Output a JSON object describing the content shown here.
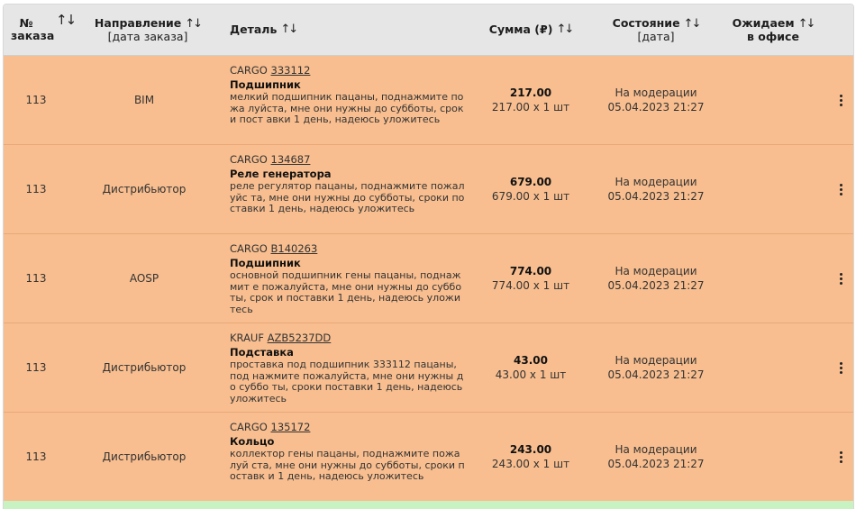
{
  "header": {
    "num": {
      "line1": "№",
      "line2": "заказа",
      "sort": "↑↓"
    },
    "direction": {
      "line1": "Направление",
      "line2": "[дата заказа]",
      "sort": "↑↓"
    },
    "detail": {
      "label": "Деталь",
      "sort": "↑↓"
    },
    "sum": {
      "label": "Сумма (₽)",
      "sort": "↑↓"
    },
    "state": {
      "line1": "Состояние",
      "line2": "[дата]",
      "sort": "↑↓"
    },
    "wait": {
      "line1": "Ожидаем",
      "line2": "в офисе",
      "sort": "↑↓"
    }
  },
  "rows": [
    {
      "num": "113",
      "direction": "BIM",
      "brand": "CARGO",
      "code": "333112",
      "title": "Подшипник",
      "desc": "мелкий подшипник пацаны, поднажмите пожа луйста, мне они нужны до субботы, сроки пост авки 1 день, надеюсь уложитесь",
      "total": "217.00",
      "unit": "217.00 x 1 шт",
      "status": "На модерации",
      "date": "05.04.2023 21:27"
    },
    {
      "num": "113",
      "direction": "Дистрибьютор",
      "brand": "CARGO",
      "code": "134687",
      "title": "Реле генератора",
      "desc": "реле регулятор пацаны, поднажмите пожалуйс та, мне они нужны до субботы, сроки поставки 1 день, надеюсь уложитесь",
      "total": "679.00",
      "unit": "679.00 x 1 шт",
      "status": "На модерации",
      "date": "05.04.2023 21:27"
    },
    {
      "num": "113",
      "direction": "AOSP",
      "brand": "CARGO",
      "code": "B140263",
      "title": "Подшипник",
      "desc": "основной подшипник гены пацаны, поднажмит е пожалуйста, мне они нужны до субботы, срок и поставки 1 день, надеюсь уложитесь",
      "total": "774.00",
      "unit": "774.00 x 1 шт",
      "status": "На модерации",
      "date": "05.04.2023 21:27"
    },
    {
      "num": "113",
      "direction": "Дистрибьютор",
      "brand": "KRAUF",
      "code": "AZB5237DD",
      "title": "Подставка",
      "desc": "проставка под подшипник 333112 пацаны, под нажмите пожалуйста, мне они нужны до суббо ты, сроки поставки 1 день, надеюсь уложитесь",
      "total": "43.00",
      "unit": "43.00 x 1 шт",
      "status": "На модерации",
      "date": "05.04.2023 21:27"
    },
    {
      "num": "113",
      "direction": "Дистрибьютор",
      "brand": "CARGO",
      "code": "135172",
      "title": "Кольцо",
      "desc": "коллектор гены пацаны, поднажмите пожалуй ста, мне они нужны до субботы, сроки поставк и 1 день, надеюсь уложитесь",
      "total": "243.00",
      "unit": "243.00 x 1 шт",
      "status": "На модерации",
      "date": "05.04.2023 21:27"
    }
  ],
  "colors": {
    "header_bg": "#e6e6e6",
    "row_bg": "#f8be8f",
    "next_row_bg": "#c9f2c2"
  },
  "icons": {
    "sort": "sort-arrows-icon",
    "menu": "kebab-menu-icon"
  }
}
